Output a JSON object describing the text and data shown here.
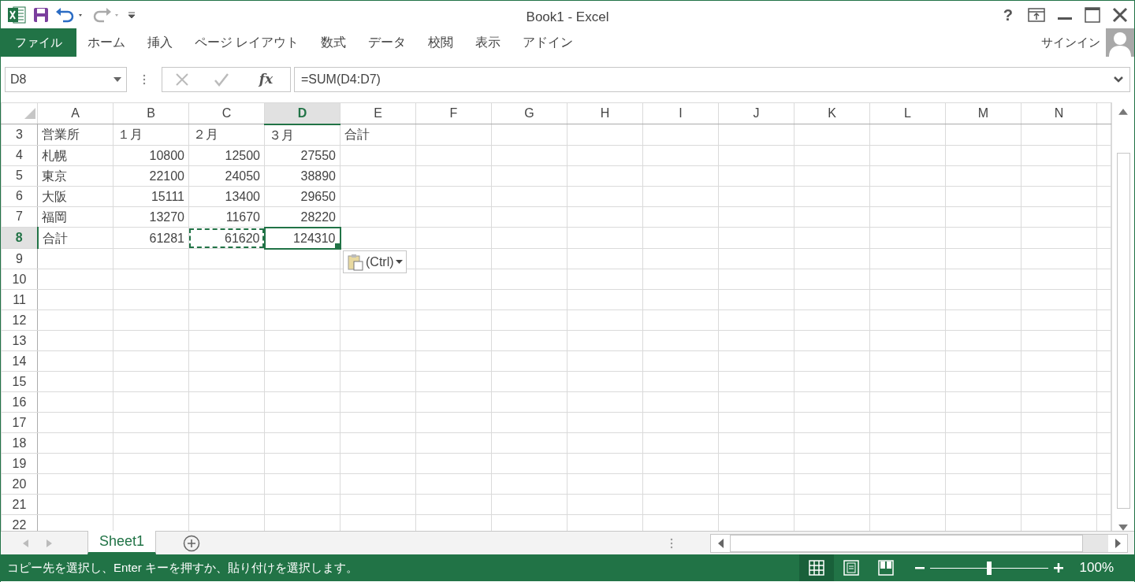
{
  "window": {
    "title": "Book1 - Excel",
    "help": "?"
  },
  "ribbon": {
    "tabs": [
      {
        "label": "ファイル",
        "kind": "file",
        "selected": false
      },
      {
        "label": "ホーム",
        "kind": "tab",
        "selected": false
      },
      {
        "label": "挿入",
        "kind": "tab",
        "selected": false
      },
      {
        "label": "ページ レイアウト",
        "kind": "tab",
        "selected": false
      },
      {
        "label": "数式",
        "kind": "tab",
        "selected": false
      },
      {
        "label": "データ",
        "kind": "tab",
        "selected": false
      },
      {
        "label": "校閲",
        "kind": "tab",
        "selected": false
      },
      {
        "label": "表示",
        "kind": "tab",
        "selected": false
      },
      {
        "label": "アドイン",
        "kind": "tab",
        "selected": false
      }
    ],
    "sign_in": "サインイン"
  },
  "formula_bar": {
    "name_box": "D8",
    "function_button": "fx",
    "formula": "=SUM(D4:D7)"
  },
  "sheet": {
    "columns": [
      {
        "label": "A",
        "selected": false
      },
      {
        "label": "B",
        "selected": false
      },
      {
        "label": "C",
        "selected": false
      },
      {
        "label": "D",
        "selected": true
      },
      {
        "label": "E",
        "selected": false
      },
      {
        "label": "F",
        "selected": false
      },
      {
        "label": "G",
        "selected": false
      },
      {
        "label": "H",
        "selected": false
      },
      {
        "label": "I",
        "selected": false
      },
      {
        "label": "J",
        "selected": false
      },
      {
        "label": "K",
        "selected": false
      },
      {
        "label": "L",
        "selected": false
      },
      {
        "label": "M",
        "selected": false
      },
      {
        "label": "N",
        "selected": false
      }
    ],
    "rows": [
      {
        "number": "3",
        "selected": false,
        "cells": [
          {
            "text": "営業所",
            "kind": "text",
            "selected": false,
            "marquee": false
          },
          {
            "text": "１月",
            "kind": "text",
            "selected": false,
            "marquee": false
          },
          {
            "text": "２月",
            "kind": "text",
            "selected": false,
            "marquee": false
          },
          {
            "text": "３月",
            "kind": "text",
            "selected": false,
            "marquee": false
          },
          {
            "text": "合計",
            "kind": "text",
            "selected": false,
            "marquee": false
          }
        ]
      },
      {
        "number": "4",
        "selected": false,
        "cells": [
          {
            "text": "札幌",
            "kind": "text",
            "selected": false,
            "marquee": false
          },
          {
            "text": "10800",
            "kind": "number",
            "selected": false,
            "marquee": false
          },
          {
            "text": "12500",
            "kind": "number",
            "selected": false,
            "marquee": false
          },
          {
            "text": "27550",
            "kind": "number",
            "selected": false,
            "marquee": false
          }
        ]
      },
      {
        "number": "5",
        "selected": false,
        "cells": [
          {
            "text": "東京",
            "kind": "text",
            "selected": false,
            "marquee": false
          },
          {
            "text": "22100",
            "kind": "number",
            "selected": false,
            "marquee": false
          },
          {
            "text": "24050",
            "kind": "number",
            "selected": false,
            "marquee": false
          },
          {
            "text": "38890",
            "kind": "number",
            "selected": false,
            "marquee": false
          }
        ]
      },
      {
        "number": "6",
        "selected": false,
        "cells": [
          {
            "text": "大阪",
            "kind": "text",
            "selected": false,
            "marquee": false
          },
          {
            "text": "15111",
            "kind": "number",
            "selected": false,
            "marquee": false
          },
          {
            "text": "13400",
            "kind": "number",
            "selected": false,
            "marquee": false
          },
          {
            "text": "29650",
            "kind": "number",
            "selected": false,
            "marquee": false
          }
        ]
      },
      {
        "number": "7",
        "selected": false,
        "cells": [
          {
            "text": "福岡",
            "kind": "text",
            "selected": false,
            "marquee": false
          },
          {
            "text": "13270",
            "kind": "number",
            "selected": false,
            "marquee": false
          },
          {
            "text": "11670",
            "kind": "number",
            "selected": false,
            "marquee": false
          },
          {
            "text": "28220",
            "kind": "number",
            "selected": false,
            "marquee": false
          }
        ]
      },
      {
        "number": "8",
        "selected": true,
        "cells": [
          {
            "text": "合計",
            "kind": "text",
            "selected": false,
            "marquee": false
          },
          {
            "text": "61281",
            "kind": "number",
            "selected": false,
            "marquee": false
          },
          {
            "text": "61620",
            "kind": "number",
            "selected": false,
            "marquee": true
          },
          {
            "text": "124310",
            "kind": "number",
            "selected": true,
            "marquee": false
          }
        ]
      },
      {
        "number": "9",
        "selected": false
      },
      {
        "number": "10",
        "selected": false
      },
      {
        "number": "11",
        "selected": false
      },
      {
        "number": "12",
        "selected": false
      },
      {
        "number": "13",
        "selected": false
      },
      {
        "number": "14",
        "selected": false
      },
      {
        "number": "15",
        "selected": false
      },
      {
        "number": "16",
        "selected": false
      },
      {
        "number": "17",
        "selected": false
      },
      {
        "number": "18",
        "selected": false
      },
      {
        "number": "19",
        "selected": false
      },
      {
        "number": "20",
        "selected": false
      },
      {
        "number": "21",
        "selected": false
      },
      {
        "number": "22",
        "selected": false
      }
    ],
    "paste_options": "(Ctrl)"
  },
  "sheet_tabs": [
    {
      "label": "Sheet1",
      "selected": true
    }
  ],
  "status_bar": {
    "message": "コピー先を選択し、Enter キーを押すか、貼り付けを選択します。",
    "views": [
      {
        "kind": "normal",
        "selected": true
      },
      {
        "kind": "page_layout",
        "selected": false
      },
      {
        "kind": "page_break",
        "selected": false
      }
    ],
    "zoom": {
      "level": 0.5,
      "reading": "100%"
    }
  }
}
